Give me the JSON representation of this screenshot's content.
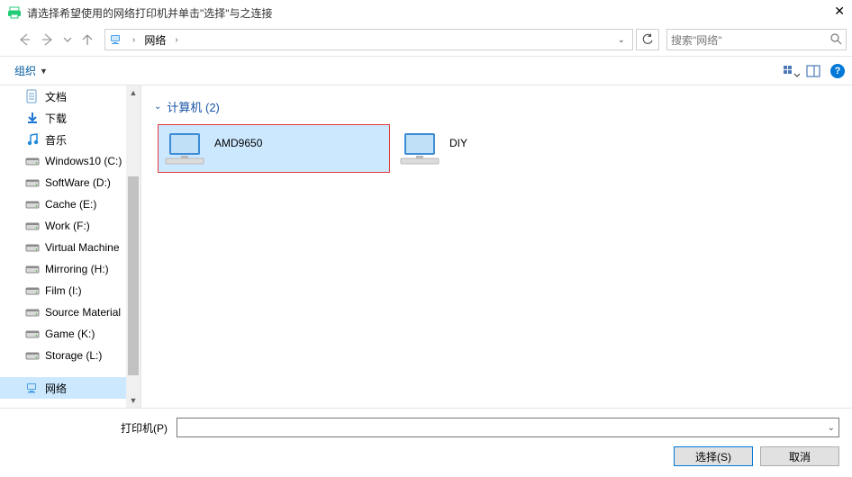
{
  "window": {
    "title": "请选择希望使用的网络打印机并单击\"选择\"与之连接",
    "close_glyph": "✕"
  },
  "nav": {
    "path_root": "网络",
    "search_placeholder": "搜索\"网络\""
  },
  "toolbar": {
    "organize_label": "组织",
    "help_glyph": "?"
  },
  "sidebar": {
    "items": [
      {
        "label": "文档",
        "icon": "doc"
      },
      {
        "label": "下载",
        "icon": "download"
      },
      {
        "label": "音乐",
        "icon": "music"
      },
      {
        "label": "Windows10 (C:)",
        "icon": "drive"
      },
      {
        "label": "SoftWare (D:)",
        "icon": "drive"
      },
      {
        "label": "Cache (E:)",
        "icon": "drive"
      },
      {
        "label": "Work (F:)",
        "icon": "drive"
      },
      {
        "label": "Virtual Machine",
        "icon": "drive"
      },
      {
        "label": "Mirroring (H:)",
        "icon": "drive"
      },
      {
        "label": "Film (I:)",
        "icon": "drive"
      },
      {
        "label": "Source Material",
        "icon": "drive"
      },
      {
        "label": "Game (K:)",
        "icon": "drive"
      },
      {
        "label": "Storage (L:)",
        "icon": "drive"
      },
      {
        "label": "网络",
        "icon": "network",
        "selected": true
      }
    ]
  },
  "content": {
    "group_label": "计算机 (2)",
    "items": [
      {
        "name": "AMD9650",
        "selected": true,
        "highlighted": true
      },
      {
        "name": "DIY",
        "selected": false,
        "highlighted": false
      }
    ]
  },
  "bottom": {
    "printer_label": "打印机(P)",
    "printer_value": "",
    "select_label": "选择(S)",
    "cancel_label": "取消"
  }
}
